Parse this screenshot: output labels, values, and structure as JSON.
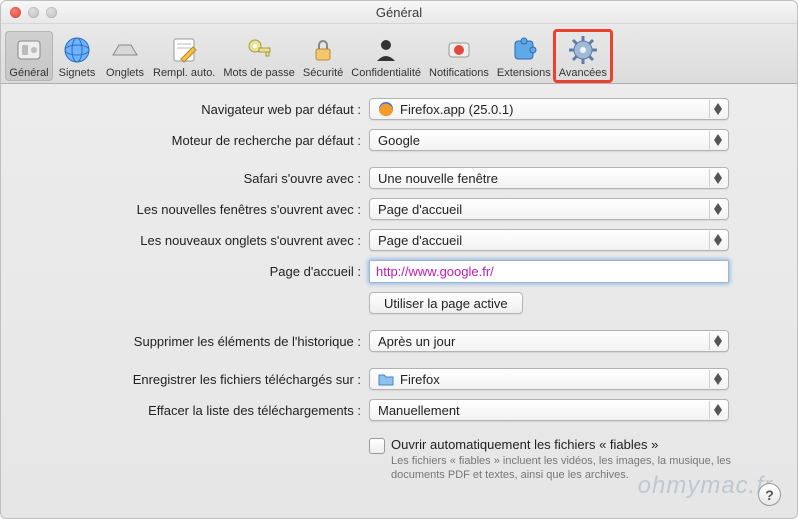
{
  "window": {
    "title": "Général"
  },
  "toolbar": {
    "items": [
      {
        "id": "general",
        "label": "Général"
      },
      {
        "id": "bookmarks",
        "label": "Signets"
      },
      {
        "id": "tabs",
        "label": "Onglets"
      },
      {
        "id": "autofill",
        "label": "Rempl. auto."
      },
      {
        "id": "passwords",
        "label": "Mots de passe"
      },
      {
        "id": "security",
        "label": "Sécurité"
      },
      {
        "id": "privacy",
        "label": "Confidentialité"
      },
      {
        "id": "notifications",
        "label": "Notifications"
      },
      {
        "id": "extensions",
        "label": "Extensions"
      },
      {
        "id": "advanced",
        "label": "Avancées"
      }
    ]
  },
  "labels": {
    "default_browser": "Navigateur web par défaut :",
    "default_search": "Moteur de recherche par défaut :",
    "opens_with": "Safari s'ouvre avec :",
    "new_windows": "Les nouvelles fenêtres s'ouvrent avec :",
    "new_tabs": "Les nouveaux onglets s'ouvrent avec :",
    "homepage": "Page d'accueil :",
    "use_current": "Utiliser la page active",
    "remove_history": "Supprimer les éléments de l'historique :",
    "download_loc": "Enregistrer les fichiers téléchargés sur :",
    "clear_downloads": "Effacer la liste des téléchargements :",
    "safe_open": "Ouvrir automatiquement les fichiers « fiables »",
    "safe_open_sub": "Les fichiers « fiables » incluent les vidéos, les images, la musique, les documents PDF et textes, ainsi que les archives."
  },
  "values": {
    "default_browser": "Firefox.app (25.0.1)",
    "default_search": "Google",
    "opens_with": "Une nouvelle fenêtre",
    "new_windows": "Page d'accueil",
    "new_tabs": "Page d'accueil",
    "homepage": "http://www.google.fr/",
    "remove_history": "Après un jour",
    "download_loc": "Firefox",
    "clear_downloads": "Manuellement",
    "safe_open_checked": false
  },
  "watermark": "ohmymac.fr"
}
